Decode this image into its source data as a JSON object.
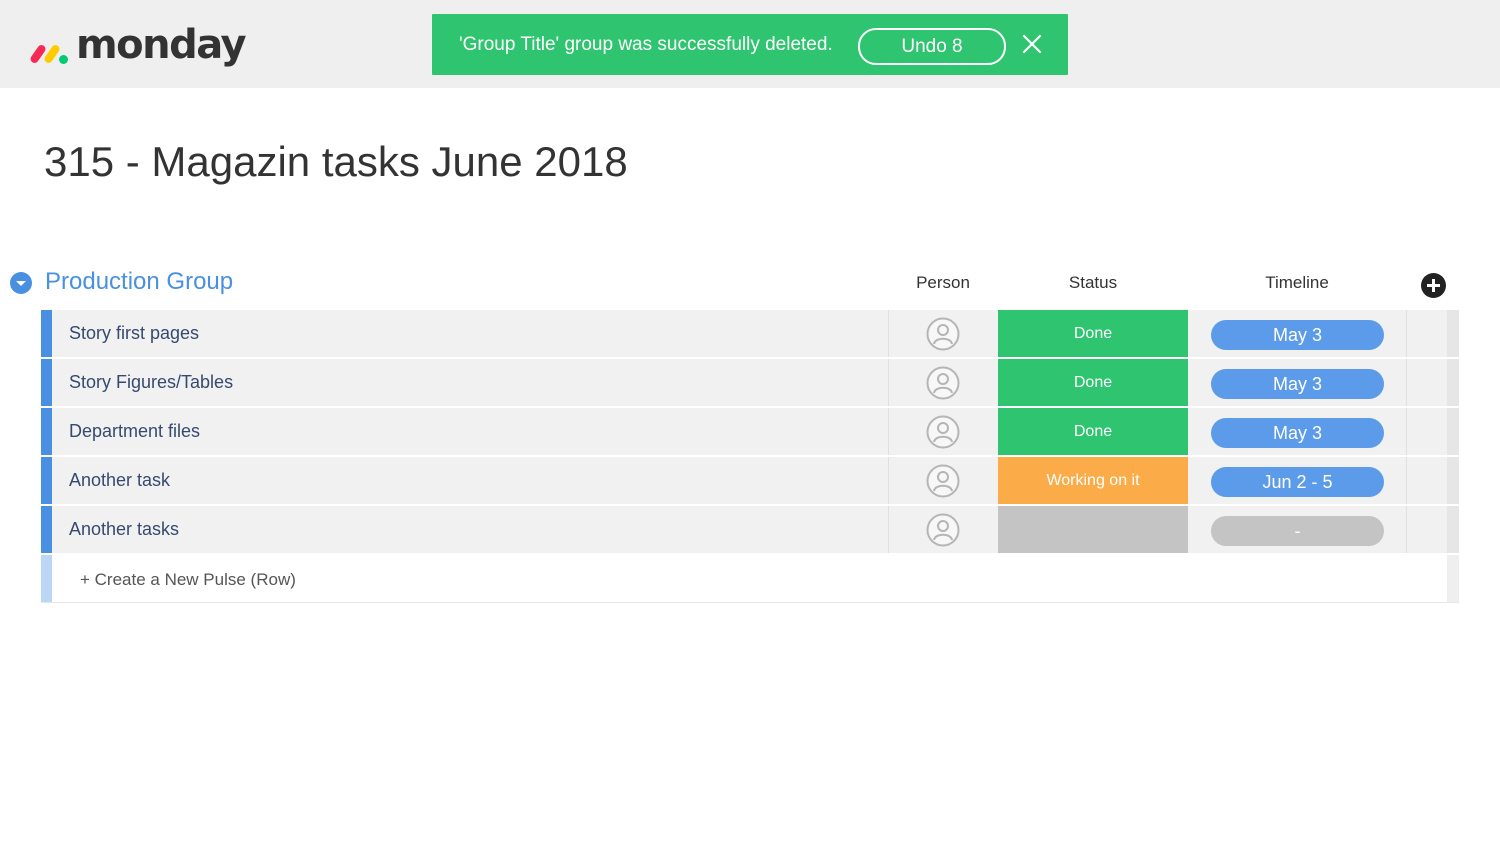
{
  "app": {
    "logo_text": "monday"
  },
  "toast": {
    "message": "'Group Title' group was successfully deleted.",
    "undo_label": "Undo 8",
    "close_icon": "close-icon",
    "bg_color": "#2fc46f"
  },
  "board": {
    "title": "315 - Magazin tasks June 2018"
  },
  "group": {
    "title": "Production Group",
    "color": "#4a90e2",
    "columns": {
      "person": "Person",
      "status": "Status",
      "timeline": "Timeline"
    },
    "rows": [
      {
        "name": "Story first pages",
        "status": "Done",
        "status_color": "#2fc46f",
        "timeline": "May 3",
        "timeline_color": "#5b9bea"
      },
      {
        "name": "Story Figures/Tables",
        "status": "Done",
        "status_color": "#2fc46f",
        "timeline": "May 3",
        "timeline_color": "#5b9bea"
      },
      {
        "name": "Department files",
        "status": "Done",
        "status_color": "#2fc46f",
        "timeline": "May 3",
        "timeline_color": "#5b9bea"
      },
      {
        "name": "Another task",
        "status": "Working on it",
        "status_color": "#fbac48",
        "timeline": "Jun 2 - 5",
        "timeline_color": "#5b9bea"
      },
      {
        "name": "Another tasks",
        "status": "",
        "status_color": "#c4c4c4",
        "timeline": "-",
        "timeline_color": "#c4c4c4"
      }
    ],
    "new_row_label": "+ Create a New Pulse (Row)"
  }
}
